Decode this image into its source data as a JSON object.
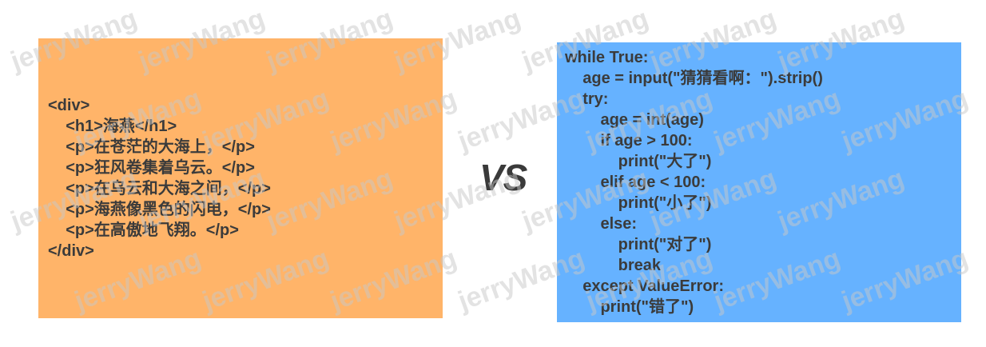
{
  "left_panel": {
    "lines": [
      "<div>",
      "    <h1>海燕</h1>",
      "    <p>在苍茫的大海上，</p>",
      "    <p>狂风卷集着乌云。</p>",
      "    <p>在乌云和大海之间，</p>",
      "    <p>海燕像黑色的闪电，</p>",
      "    <p>在高傲地飞翔。</p>",
      "</div>"
    ]
  },
  "separator": {
    "label": "VS"
  },
  "right_panel": {
    "lines": [
      "while True:",
      "    age = input(\"猜猜看啊：\").strip()",
      "    try:",
      "        age = int(age)",
      "        if age > 100:",
      "            print(\"大了\")",
      "        elif age < 100:",
      "            print(\"小了\")",
      "        else:",
      "            print(\"对了\")",
      "            break",
      "    except ValueError:",
      "        print(\"错了\")"
    ]
  },
  "watermark": {
    "text": "jerryWang"
  },
  "colors": {
    "left_panel_bg": "#FFB469",
    "right_panel_bg": "#66B2FF",
    "code_text": "#3B3B3B",
    "separator_text": "#3A3A3A"
  }
}
